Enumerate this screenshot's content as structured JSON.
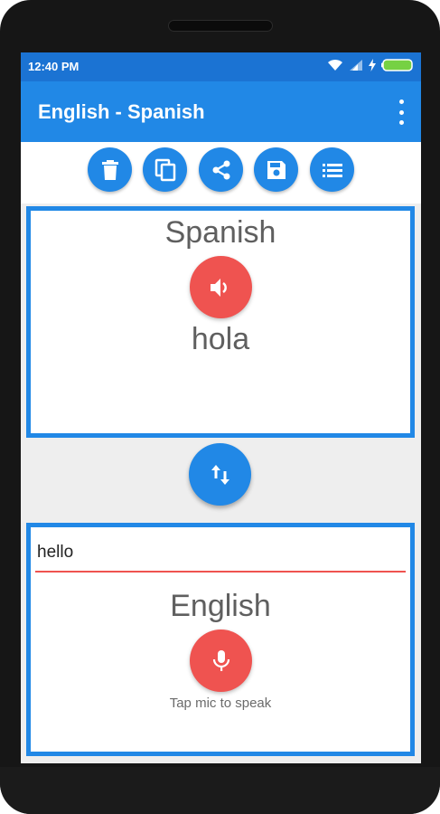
{
  "status_bar": {
    "time": "12:40 PM",
    "icons": [
      "wifi-icon",
      "signal-icon",
      "charging-icon",
      "battery-icon"
    ]
  },
  "app_bar": {
    "title": "English - Spanish",
    "overflow_icon": "more-vert-icon"
  },
  "toolbar": {
    "buttons": [
      "delete-icon",
      "copy-icon",
      "share-icon",
      "save-icon",
      "list-icon"
    ]
  },
  "output": {
    "language": "Spanish",
    "text": "hola",
    "speak_icon": "speaker-icon"
  },
  "swap": {
    "icon": "swap-vertical-icon"
  },
  "input": {
    "value": "hello",
    "language": "English",
    "mic_icon": "microphone-icon",
    "hint": "Tap mic to speak"
  },
  "colors": {
    "primary": "#2188e6",
    "status_bar": "#1b73d3",
    "accent": "#ef5350",
    "battery": "#76d143"
  }
}
